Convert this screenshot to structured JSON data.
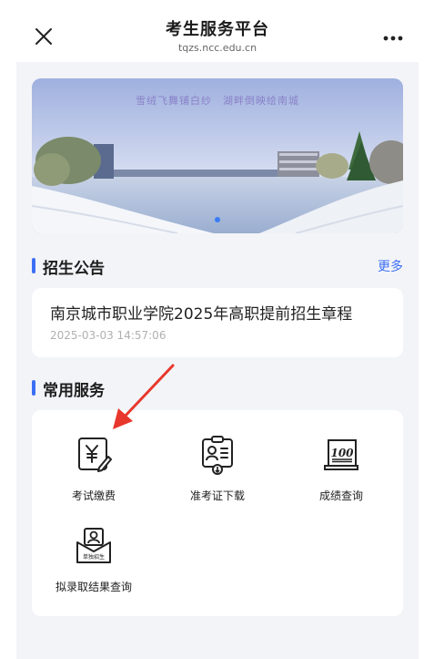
{
  "header": {
    "title": "考生服务平台",
    "domain": "tqzs.ncc.edu.cn"
  },
  "banner": {
    "caption": "雪绒飞舞铺白纱　湖畔倒映绘南城"
  },
  "notices": {
    "heading": "招生公告",
    "more_label": "更多",
    "items": [
      {
        "title": "南京城市职业学院2025年高职提前招生章程",
        "time": "2025-03-03 14:57:06"
      }
    ]
  },
  "services": {
    "heading": "常用服务",
    "items": [
      {
        "label": "考试缴费",
        "icon": "yen-payment-icon"
      },
      {
        "label": "准考证下载",
        "icon": "admission-ticket-icon"
      },
      {
        "label": "成绩查询",
        "icon": "score-100-icon"
      },
      {
        "label": "拟录取结果查询",
        "icon": "admission-result-icon"
      }
    ],
    "stamp_text": "单独招生"
  },
  "colors": {
    "accent": "#3d6ff5",
    "annotation_arrow": "#e8372c"
  }
}
